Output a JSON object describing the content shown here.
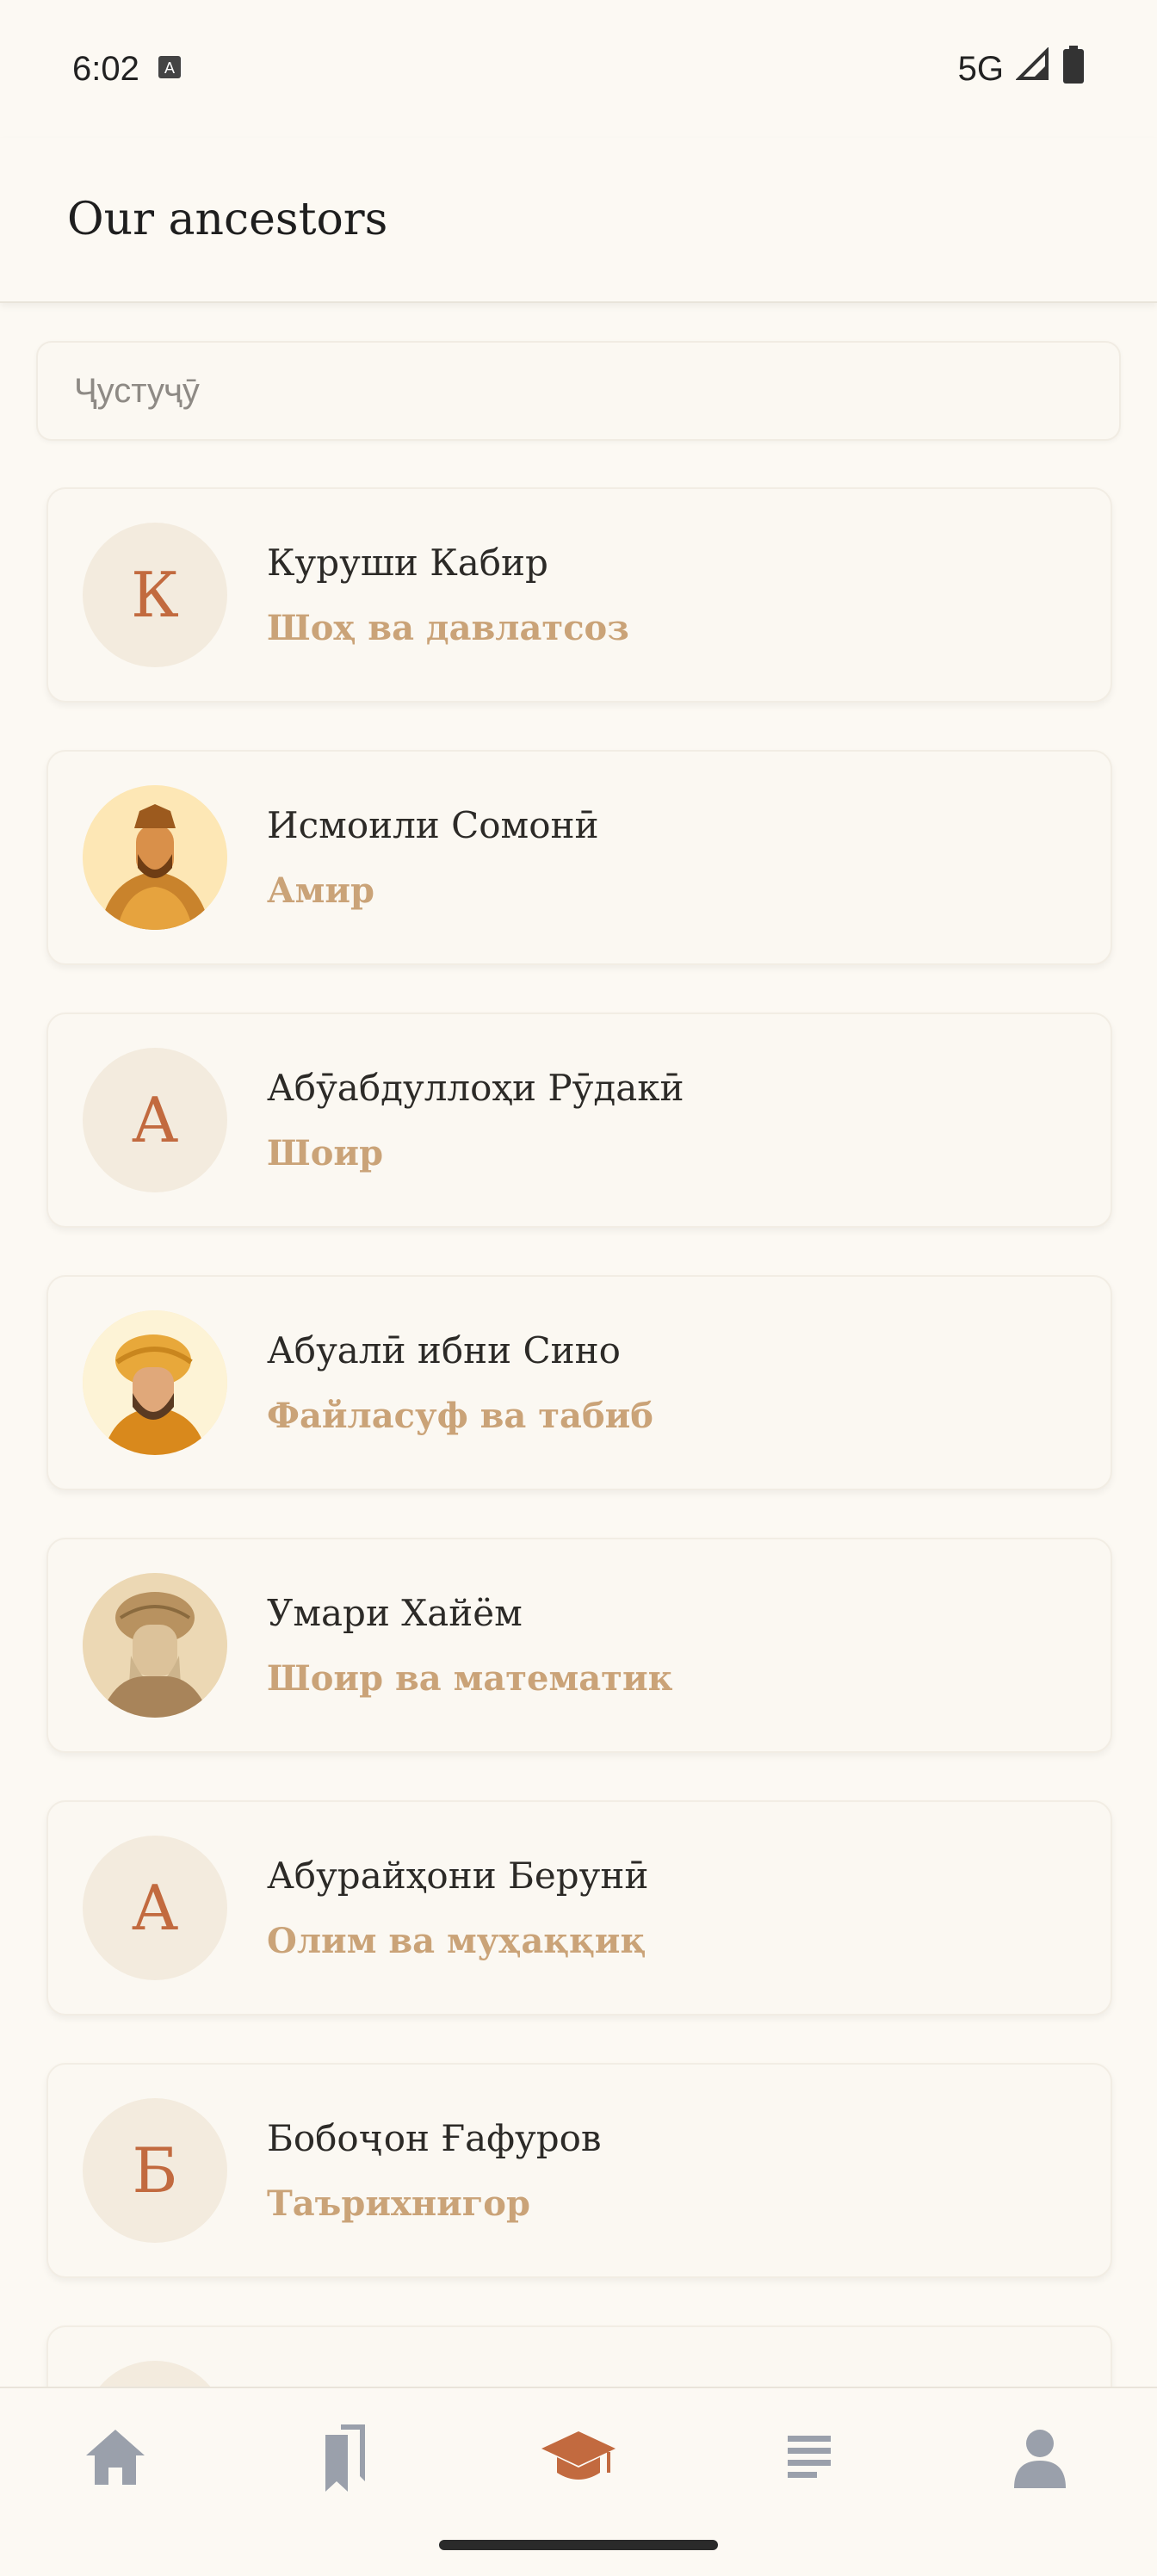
{
  "status": {
    "time": "6:02",
    "network": "5G"
  },
  "app": {
    "title": "Our ancestors"
  },
  "search": {
    "placeholder": "Ҷустуҷӯ"
  },
  "ancestors": [
    {
      "initial": "К",
      "name": "Куруши Кабир",
      "role": "Шоҳ ва давлатсоз",
      "photo": null
    },
    {
      "initial": "",
      "name": "Исмоили Сомонӣ",
      "role": "Амир",
      "photo": "warrior-portrait"
    },
    {
      "initial": "А",
      "name": "Абӯабдуллоҳи Рӯдакӣ",
      "role": "Шоир",
      "photo": null
    },
    {
      "initial": "",
      "name": "Абуалӣ ибни Сино",
      "role": "Файласуф ва табиб",
      "photo": "scholar-turban-portrait"
    },
    {
      "initial": "",
      "name": "Умари Хайём",
      "role": "Шоир ва математик",
      "photo": "sepia-engraving-portrait"
    },
    {
      "initial": "А",
      "name": "Абурайҳони Берунӣ",
      "role": "Олим ва муҳаққиқ",
      "photo": null
    },
    {
      "initial": "Б",
      "name": "Бобоҷон Ғафуров",
      "role": "Таърихнигор",
      "photo": null
    }
  ],
  "nav": [
    {
      "icon": "home-icon",
      "active": false
    },
    {
      "icon": "bookmarks-icon",
      "active": false
    },
    {
      "icon": "graduation-cap-icon",
      "active": true
    },
    {
      "icon": "list-icon",
      "active": false
    },
    {
      "icon": "profile-icon",
      "active": false
    }
  ],
  "colors": {
    "accent": "#c26a3f",
    "role_text": "#caa378",
    "nav_inactive": "#9aa0ab",
    "background": "#fcf9f3"
  }
}
